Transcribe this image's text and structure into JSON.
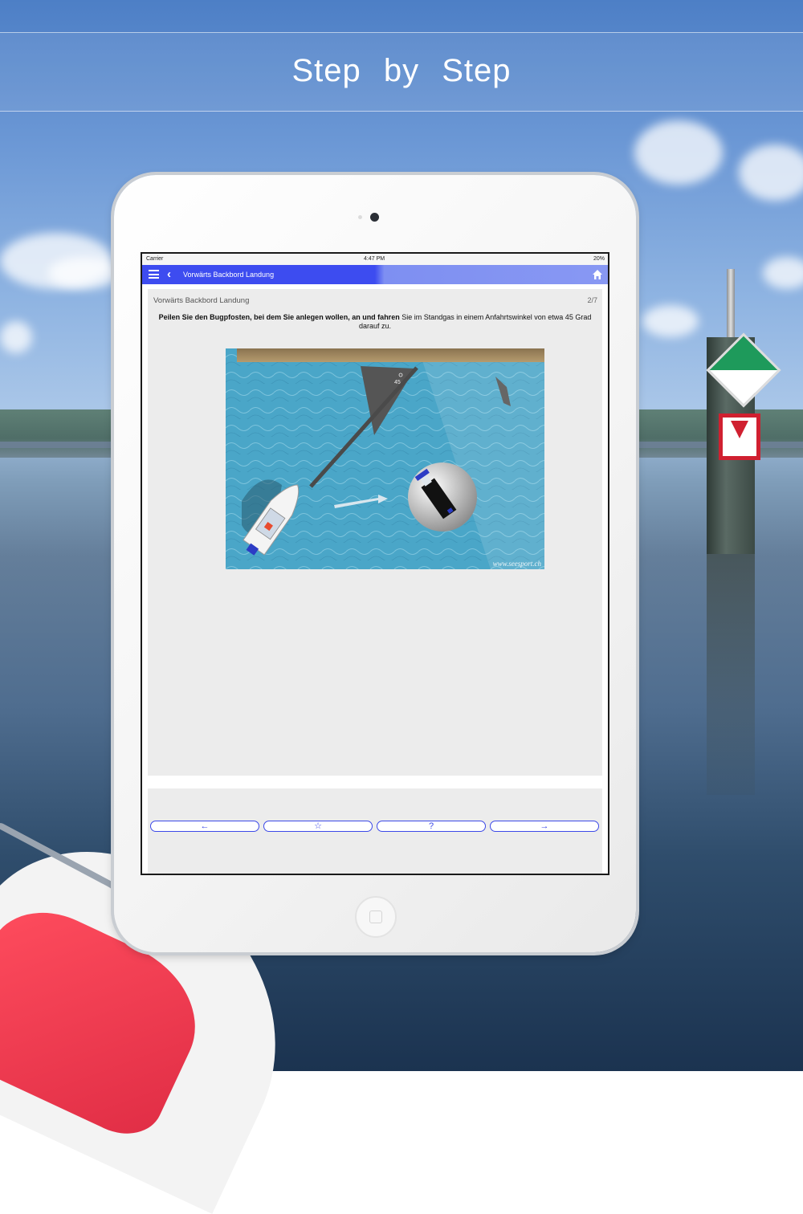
{
  "header": {
    "title": "Step by Step"
  },
  "device": {
    "status": {
      "carrier": "Carrier",
      "time": "4:47 PM",
      "battery": "20%"
    },
    "nav": {
      "title": "Vorwärts Backbord Landung"
    },
    "content": {
      "subtitle": "Vorwärts Backbord Landung",
      "page": "2/7",
      "instruction_bold": "Peilen Sie den Bugpfosten, bei dem Sie anlegen wollen, an und fahren",
      "instruction_rest": " Sie im Standgas in einem Anfahrtswinkel von etwa 45 Grad darauf zu."
    },
    "diagram": {
      "angle_label": "45",
      "watermark": "www.seesport.ch"
    },
    "controls": {
      "prev": "←",
      "favorite": "☆",
      "help": "?",
      "next": "→"
    }
  },
  "colors": {
    "accent": "#3c49e8",
    "nav_bar": "#3d4cf0",
    "water": "#4aa6c8"
  }
}
